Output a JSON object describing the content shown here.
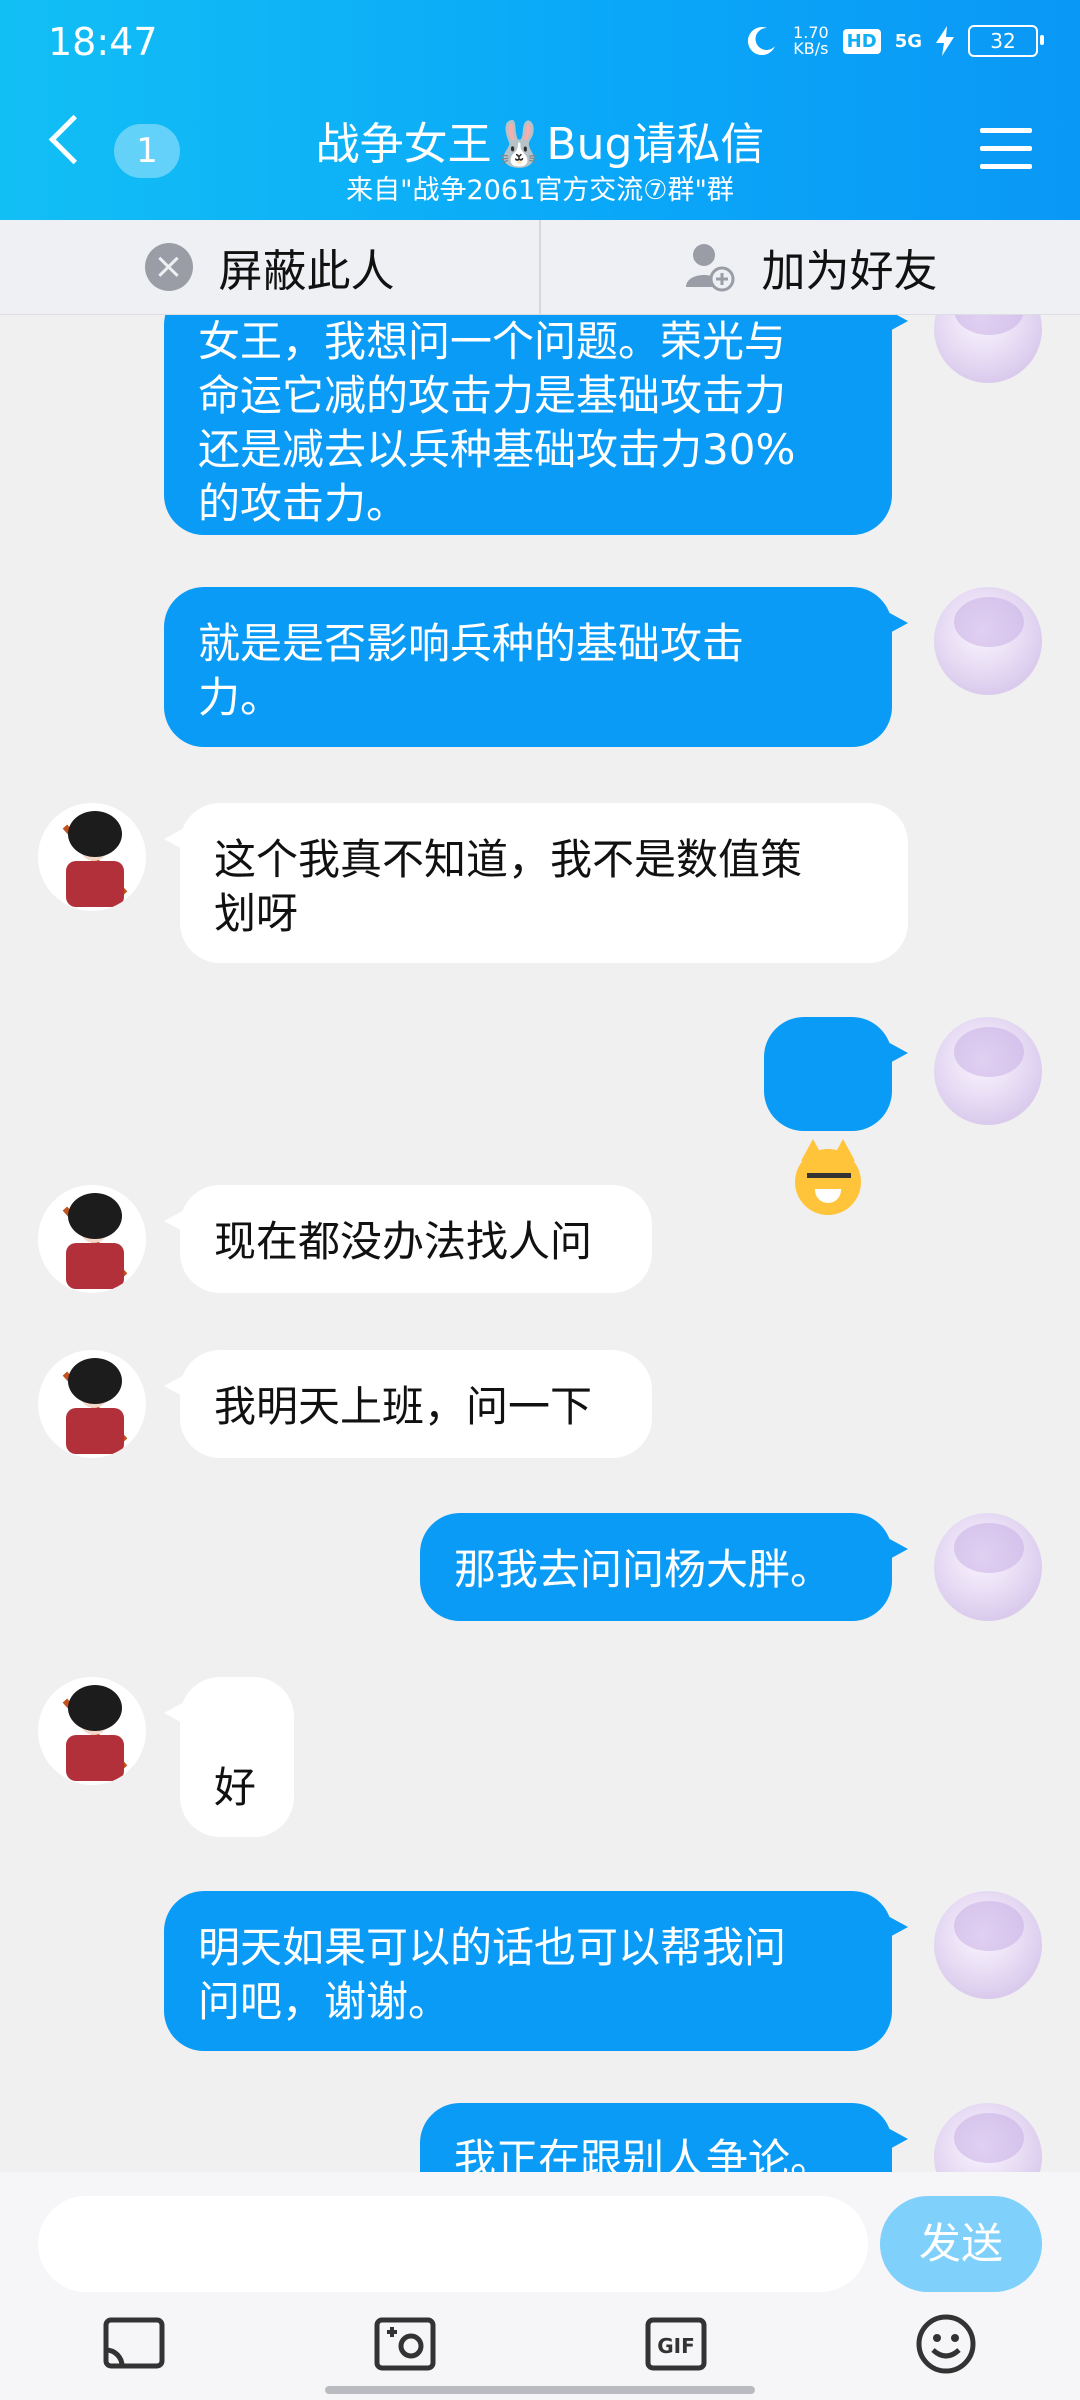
{
  "status_bar": {
    "time": "18:47",
    "net_speed_value": "1.70",
    "net_speed_unit": "KB/s",
    "hd_label": "HD",
    "signal_label": "5G",
    "battery": "32"
  },
  "header": {
    "unread_count": "1",
    "title": "战争女王🐰Bug请私信",
    "subtitle": "来自\"战争2061官方交流⑦群\"群"
  },
  "actions": {
    "block_label": "屏蔽此人",
    "add_friend_label": "加为好友"
  },
  "messages": [
    {
      "sender": "me",
      "text": "女王，我想问一个问题。荣光与\n命运它减的攻击力是基础攻击力\n还是减去以兵种基础攻击力30%\n的攻击力。"
    },
    {
      "sender": "me",
      "text": "就是是否影响兵种的基础攻击\n力。"
    },
    {
      "sender": "other",
      "text": "这个我真不知道，我不是数值策\n划呀"
    },
    {
      "sender": "me",
      "text": "",
      "sticker": "smug-cat-emoji"
    },
    {
      "sender": "other",
      "text": "现在都没办法找人问"
    },
    {
      "sender": "other",
      "text": "我明天上班，问一下"
    },
    {
      "sender": "me",
      "text": "那我去问问杨大胖。"
    },
    {
      "sender": "other",
      "text": "\n好"
    },
    {
      "sender": "me",
      "text": "明天如果可以的话也可以帮我问\n问吧，谢谢。"
    },
    {
      "sender": "me",
      "text": "我正在跟别人争论。"
    }
  ],
  "composer": {
    "input_value": "",
    "send_label": "发送"
  },
  "colors": {
    "header_blue": "#0aa6f8",
    "bubble_me": "#0a9bf6",
    "send_button": "#7fd0fb"
  },
  "icons": [
    "back-icon",
    "menu-icon",
    "block-icon",
    "add-friend-icon",
    "screen-share-icon",
    "photo-icon",
    "gif-icon",
    "emoji-icon"
  ]
}
